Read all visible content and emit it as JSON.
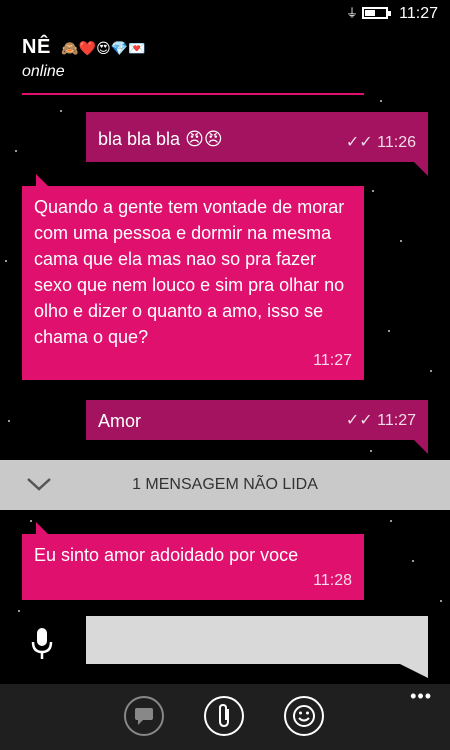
{
  "status": {
    "time": "11:27"
  },
  "contact": {
    "name": "NÊ",
    "emojis": "🙈❤️😍💎💌",
    "status": "online"
  },
  "messages": [
    {
      "direction": "out",
      "text": "bla bla bla 😠😠",
      "time": "11:26",
      "check": "✓✓"
    },
    {
      "direction": "in",
      "text": "Quando a gente tem vontade de morar com uma pessoa e dormir na mesma cama que ela mas nao so pra fazer sexo que nem louco e sim pra olhar no olho e dizer o quanto a amo, isso se chama o que?",
      "time": "11:27"
    },
    {
      "direction": "out",
      "text": "Amor",
      "time": "11:27",
      "check": "✓✓"
    },
    {
      "direction": "in",
      "text": "Eu sinto amor adoidado por voce",
      "time": "11:28"
    }
  ],
  "unread": {
    "label": "1 MENSAGEM NÃO LIDA",
    "icon": "chevron-down-icon"
  },
  "compose": {
    "value": ""
  },
  "app_bar": {
    "more": "•••",
    "buttons": [
      "chat-heads-icon",
      "paperclip-icon",
      "smiley-icon"
    ]
  },
  "colors": {
    "incoming": "#e0106e",
    "outgoing": "#a3135f",
    "background": "#000000"
  }
}
